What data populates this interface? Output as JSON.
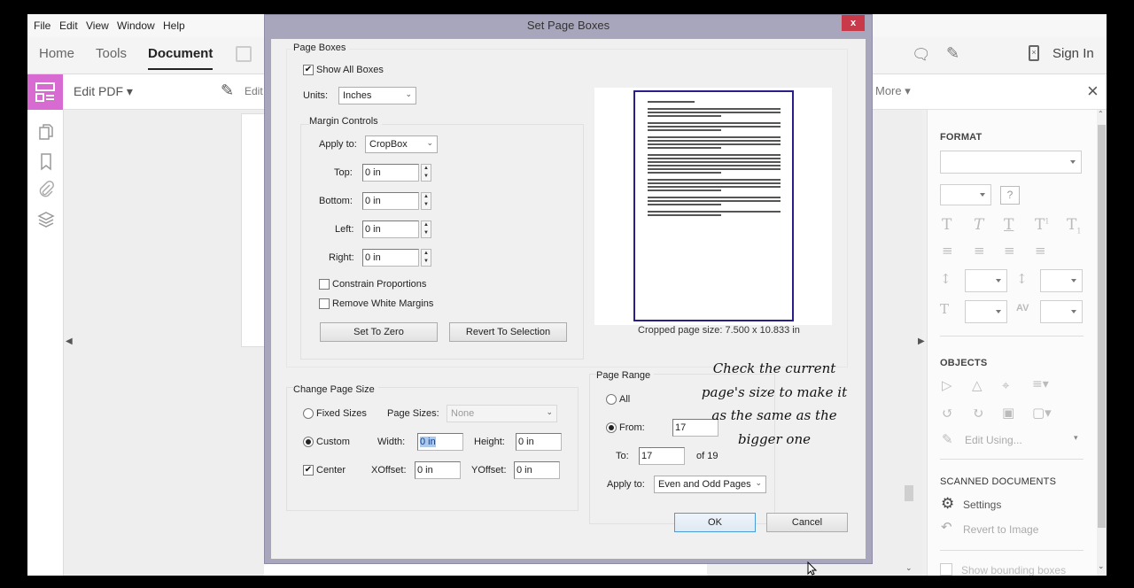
{
  "menu": [
    "File",
    "Edit",
    "View",
    "Window",
    "Help"
  ],
  "top_tabs": [
    {
      "label": "Home",
      "active": false
    },
    {
      "label": "Tools",
      "active": false
    },
    {
      "label": "Document",
      "active": true
    }
  ],
  "top_right": {
    "sign_in": "Sign In"
  },
  "toolbar": {
    "edit_pdf": "Edit PDF ▾",
    "edit": "Edit",
    "more": "More ▾"
  },
  "right_panel": {
    "format_heading": "FORMAT",
    "objects_heading": "OBJECTS",
    "edit_using": "Edit Using...",
    "scanned_heading": "SCANNED DOCUMENTS",
    "settings": "Settings",
    "revert_to_image": "Revert to Image",
    "show_bounding_boxes": "Show bounding boxes"
  },
  "dialog": {
    "title": "Set Page Boxes",
    "close": "x",
    "page_boxes": {
      "title": "Page Boxes",
      "show_all_boxes": "Show All Boxes",
      "show_all_boxes_checked": true,
      "units_label": "Units:",
      "units_value": "Inches"
    },
    "margin_controls": {
      "title": "Margin Controls",
      "apply_to_label": "Apply to:",
      "apply_to_value": "CropBox",
      "top_label": "Top:",
      "top_value": "0 in",
      "bottom_label": "Bottom:",
      "bottom_value": "0 in",
      "left_label": "Left:",
      "left_value": "0 in",
      "right_label": "Right:",
      "right_value": "0 in",
      "constrain": "Constrain Proportions",
      "remove_white": "Remove White Margins",
      "set_to_zero": "Set To Zero",
      "revert_to_selection": "Revert To Selection"
    },
    "preview": {
      "cropped_size": "Cropped page size: 7.500 x 10.833 in"
    },
    "change_page_size": {
      "title": "Change Page Size",
      "fixed_sizes": "Fixed Sizes",
      "page_sizes_label": "Page Sizes:",
      "page_sizes_value": "None",
      "custom": "Custom",
      "width_label": "Width:",
      "width_value": "0 in",
      "height_label": "Height:",
      "height_value": "0 in",
      "center": "Center",
      "center_checked": true,
      "xoffset_label": "XOffset:",
      "xoffset_value": "0 in",
      "yoffset_label": "YOffset:",
      "yoffset_value": "0 in"
    },
    "page_range": {
      "title": "Page Range",
      "all": "All",
      "from_label": "From:",
      "from_value": "17",
      "to_label": "To:",
      "to_value": "17",
      "of_total": "of 19",
      "apply_to_label": "Apply to:",
      "apply_to_value": "Even and Odd Pages"
    },
    "ok": "OK",
    "cancel": "Cancel"
  },
  "annotation": "Check the current page's size to make it as the same as the bigger one"
}
